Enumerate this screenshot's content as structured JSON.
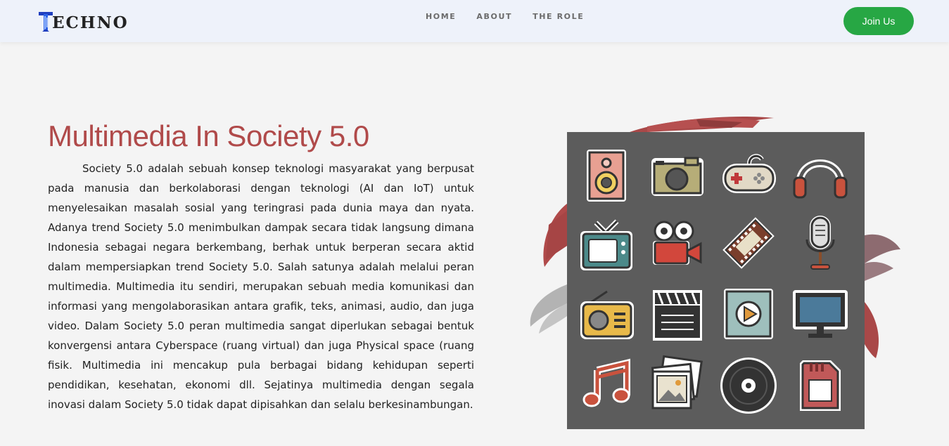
{
  "nav": {
    "brand": "ECHNO",
    "logo_letter": "T",
    "links": [
      "HOME",
      "ABOUT",
      "THE ROLE"
    ],
    "cta": "Join Us"
  },
  "main": {
    "title": "Multimedia In Society 5.0",
    "body": "Society 5.0 adalah sebuah konsep teknologi masyarakat yang berpusat pada manusia dan berkolaborasi dengan teknologi (AI dan IoT) untuk menyelesaikan masalah sosial yang teringrasi pada dunia maya dan nyata. Adanya trend Society 5.0 menimbulkan dampak secara tidak langsung dimana Indonesia sebagai negara berkembang, berhak untuk berperan secara aktid dalam mempersiapkan trend Society 5.0. Salah satunya adalah melalui peran multimedia. Multimedia itu sendiri, merupakan sebuah media komunikasi dan informasi yang mengolaborasikan antara grafik, teks, animasi, audio, dan juga video. Dalam Society 5.0 peran multimedia sangat diperlukan sebagai bentuk konvergensi antara Cyberspace (ruang virtual) dan juga Physical space (ruang fisik. Multimedia ini mencakup pula berbagai bidang kehidupan seperti pendidikan, kesehatan, ekonomi dll. Sejatinya multimedia dengan segala inovasi dalam Society 5.0 tidak dapat dipisahkan dan selalu berkesinambungan."
  },
  "illustration": {
    "icons": [
      "speaker-icon",
      "camera-icon",
      "gamepad-icon",
      "headphones-icon",
      "tv-icon",
      "video-camera-icon",
      "film-strip-icon",
      "microphone-icon",
      "radio-icon",
      "clapperboard-icon",
      "play-icon",
      "monitor-icon",
      "music-note-icon",
      "photos-icon",
      "vinyl-record-icon",
      "sd-card-icon"
    ],
    "colors": {
      "panel": "#5c5c5c",
      "brush_red": "#b04a4a",
      "brush_gray": "#b5b5b5",
      "accent_green": "#27a744",
      "title_red": "#b04a4a"
    }
  }
}
